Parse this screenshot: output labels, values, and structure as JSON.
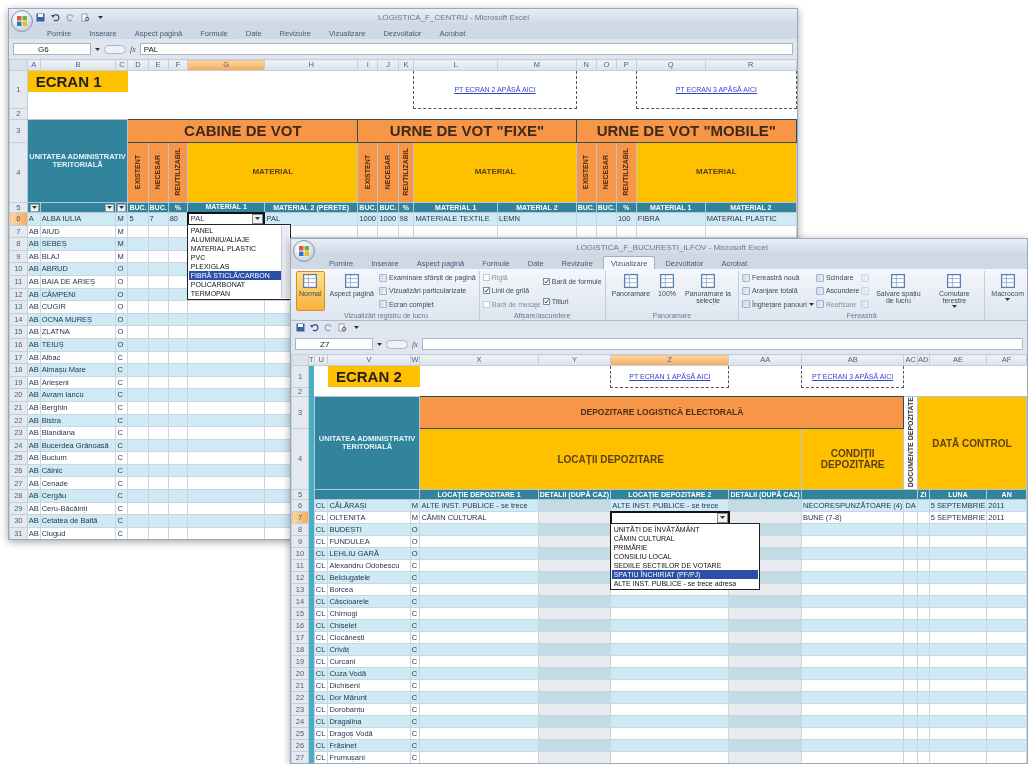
{
  "windows": [
    {
      "title": "LOGISTICA_F_CENTRU - Microsoft Excel",
      "tabs": [
        {
          "label": "Pornire",
          "selected": false
        },
        {
          "label": "Inserare",
          "selected": false
        },
        {
          "label": "Aspect pagină",
          "selected": false
        },
        {
          "label": "Formule",
          "selected": false
        },
        {
          "label": "Date",
          "selected": false
        },
        {
          "label": "Revizuire",
          "selected": false
        },
        {
          "label": "Vizualizare",
          "selected": false
        },
        {
          "label": "Dezvoltator",
          "selected": false
        },
        {
          "label": "Acrobat",
          "selected": false
        }
      ],
      "name_box": "G6",
      "function_label": "fx",
      "formula": "PAL",
      "columns": [
        {
          "label": "A",
          "selected": false
        },
        {
          "label": "B",
          "selected": false
        },
        {
          "label": "C",
          "selected": false
        },
        {
          "label": "D",
          "selected": false
        },
        {
          "label": "E",
          "selected": false
        },
        {
          "label": "F",
          "selected": false
        },
        {
          "label": "G",
          "selected": true
        },
        {
          "label": "H",
          "selected": false
        },
        {
          "label": "I",
          "selected": false
        },
        {
          "label": "J",
          "selected": false
        },
        {
          "label": "K",
          "selected": false
        },
        {
          "label": "L",
          "selected": false
        },
        {
          "label": "M",
          "selected": false
        },
        {
          "label": "N",
          "selected": false
        },
        {
          "label": "O",
          "selected": false
        },
        {
          "label": "P",
          "selected": false
        },
        {
          "label": "Q",
          "selected": false
        },
        {
          "label": "R",
          "selected": false
        }
      ],
      "header_rows": [
        {
          "number": "1",
          "cells": [
            {
              "kind": "title",
              "text": "ECRAN 1"
            },
            {
              "kind": "link",
              "text": "PT ECRAN 2 APĂSĂ AICI"
            },
            {
              "kind": "link",
              "text": "PT ECRAN 3 APĂSĂ AICI"
            }
          ]
        },
        {
          "number": "2",
          "cells": []
        },
        {
          "number": "3",
          "cells": [
            {
              "kind": "teal",
              "text": "UNITATEA ADMINISTRATIV TERITORIALĂ"
            },
            {
              "kind": "section",
              "text": "CABINE DE VOT"
            },
            {
              "kind": "section",
              "text": "URNE DE VOT \"FIXE\""
            },
            {
              "kind": "section",
              "text": "URNE DE VOT \"MOBILE\""
            }
          ]
        },
        {
          "number": "4",
          "cells": [
            {
              "kind": "vorange",
              "text": "EXISTENT"
            },
            {
              "kind": "vorange",
              "text": "NECESAR"
            },
            {
              "kind": "vorange",
              "text": "REUTILIZABIL"
            },
            {
              "kind": "yellow",
              "text": "MATERIAL"
            },
            {
              "kind": "vorange",
              "text": "EXISTENT"
            },
            {
              "kind": "vorange",
              "text": "NECESAR"
            },
            {
              "kind": "vorange",
              "text": "REUTILIZABIL"
            },
            {
              "kind": "yellow",
              "text": "MATERIAL"
            },
            {
              "kind": "vorange",
              "text": "EXISTENT"
            },
            {
              "kind": "vorange",
              "text": "NECESAR"
            },
            {
              "kind": "vorange",
              "text": "REUTILIZABIL"
            },
            {
              "kind": "yellow",
              "text": "MATERIAL"
            }
          ]
        },
        {
          "number": "5",
          "cells": [
            {
              "kind": "filter"
            },
            {
              "kind": "filter"
            },
            {
              "kind": "filter"
            },
            {
              "kind": "dark",
              "text": "BUC."
            },
            {
              "kind": "dark",
              "text": "BUC."
            },
            {
              "kind": "dark",
              "text": "%"
            },
            {
              "kind": "dark",
              "text": "MATERIAL 1"
            },
            {
              "kind": "dark",
              "text": "MATERIAL 2 (PERETE)"
            },
            {
              "kind": "dark",
              "text": "BUC."
            },
            {
              "kind": "dark",
              "text": "BUC."
            },
            {
              "kind": "dark",
              "text": "%"
            },
            {
              "kind": "dark",
              "text": "MATERIAL 1"
            },
            {
              "kind": "dark",
              "text": "MATERIAL 2"
            },
            {
              "kind": "dark",
              "text": "BUC."
            },
            {
              "kind": "dark",
              "text": "BUC."
            },
            {
              "kind": "dark",
              "text": "%"
            },
            {
              "kind": "dark",
              "text": "MATERIAL 1"
            },
            {
              "kind": "dark",
              "text": "MATERIAL 2"
            }
          ]
        }
      ],
      "rows": [
        {
          "number": "6",
          "selected": true,
          "cells": [
            "A",
            "ALBA IULIA",
            "M",
            "5",
            "7",
            "80",
            "PAL",
            "PAL",
            "1000",
            "1000",
            "98",
            "MATERIALE TEXTILE",
            "LEMN",
            null,
            null,
            "100",
            "FIBRA",
            "MATERIAL PLASTIC"
          ]
        },
        {
          "number": "7",
          "selected": false,
          "cells": [
            "AB",
            "AIUD",
            "M"
          ]
        },
        {
          "number": "8",
          "selected": false,
          "cells": [
            "AB",
            "SEBEȘ",
            "M"
          ]
        },
        {
          "number": "9",
          "selected": false,
          "cells": [
            "AB",
            "BLAJ",
            "M"
          ]
        },
        {
          "number": "10",
          "selected": false,
          "cells": [
            "AB",
            "ABRUD",
            "O"
          ]
        },
        {
          "number": "11",
          "selected": false,
          "cells": [
            "AB",
            "BAIA DE ARIEȘ",
            "O"
          ]
        },
        {
          "number": "12",
          "selected": false,
          "cells": [
            "AB",
            "CÂMPENI",
            "O"
          ]
        },
        {
          "number": "13",
          "selected": false,
          "cells": [
            "AB",
            "CUGIR",
            "O"
          ]
        },
        {
          "number": "14",
          "selected": false,
          "cells": [
            "AB",
            "OCNA MUREȘ",
            "O"
          ]
        },
        {
          "number": "15",
          "selected": false,
          "cells": [
            "AB",
            "ZLATNA",
            "O"
          ]
        },
        {
          "number": "16",
          "selected": false,
          "cells": [
            "AB",
            "TEIUȘ",
            "O"
          ]
        },
        {
          "number": "17",
          "selected": false,
          "cells": [
            "AB",
            "Albac",
            "C"
          ]
        },
        {
          "number": "18",
          "selected": false,
          "cells": [
            "AB",
            "Almașu Mare",
            "C"
          ]
        },
        {
          "number": "19",
          "selected": false,
          "cells": [
            "AB",
            "Arieșeni",
            "C"
          ]
        },
        {
          "number": "20",
          "selected": false,
          "cells": [
            "AB",
            "Avram Iancu",
            "C"
          ]
        },
        {
          "number": "21",
          "selected": false,
          "cells": [
            "AB",
            "Berghin",
            "C"
          ]
        },
        {
          "number": "22",
          "selected": false,
          "cells": [
            "AB",
            "Bistra",
            "C"
          ]
        },
        {
          "number": "23",
          "selected": false,
          "cells": [
            "AB",
            "Blandiana",
            "C"
          ]
        },
        {
          "number": "24",
          "selected": false,
          "cells": [
            "AB",
            "Bucerdea Grânoasă",
            "C"
          ]
        },
        {
          "number": "25",
          "selected": false,
          "cells": [
            "AB",
            "Bucium",
            "C"
          ]
        },
        {
          "number": "26",
          "selected": false,
          "cells": [
            "AB",
            "Câlnic",
            "C"
          ]
        },
        {
          "number": "27",
          "selected": false,
          "cells": [
            "AB",
            "Cenade",
            "C"
          ]
        },
        {
          "number": "28",
          "selected": false,
          "cells": [
            "AB",
            "Cergău",
            "C"
          ]
        },
        {
          "number": "29",
          "selected": false,
          "cells": [
            "AB",
            "Ceru-Băcăinți",
            "C"
          ]
        },
        {
          "number": "30",
          "selected": false,
          "cells": [
            "AB",
            "Cetatea de Baltă",
            "C"
          ]
        },
        {
          "number": "31",
          "selected": false,
          "cells": [
            "AB",
            "Ciugud",
            "C"
          ]
        }
      ],
      "dropdown": [
        {
          "label": "PANEL",
          "selected": false
        },
        {
          "label": "ALUMINIU/ALIAJE",
          "selected": false
        },
        {
          "label": "MATERIAL PLASTIC",
          "selected": false
        },
        {
          "label": "PVC",
          "selected": false
        },
        {
          "label": "PLEXIGLAS",
          "selected": false
        },
        {
          "label": "FIBRĂ STICLĂ/CARBON",
          "selected": true
        },
        {
          "label": "POLICARBONAT",
          "selected": false
        },
        {
          "label": "TERMOPAN",
          "selected": false
        }
      ]
    },
    {
      "title": "LOGISTICA_F_BUCUREȘTI_ILFOV - Microsoft Excel",
      "tabs": [
        {
          "label": "Pornire",
          "selected": false
        },
        {
          "label": "Inserare",
          "selected": false
        },
        {
          "label": "Aspect pagină",
          "selected": false
        },
        {
          "label": "Formule",
          "selected": false
        },
        {
          "label": "Date",
          "selected": false
        },
        {
          "label": "Revizuire",
          "selected": false
        },
        {
          "label": "Vizualizare",
          "selected": true
        },
        {
          "label": "Dezvoltator",
          "selected": false
        },
        {
          "label": "Acrobat",
          "selected": false
        }
      ],
      "ribbon": [
        {
          "label": "Vizualizări registru de lucru",
          "items": [
            {
              "kind": "large",
              "label": "Normal",
              "selected": true
            },
            {
              "kind": "large",
              "label": "Aspect pagină",
              "selected": false
            },
            {
              "kind": "small",
              "label": "Examinare sfârșit de pagină",
              "disabled": false
            },
            {
              "kind": "small",
              "label": "Vizualizări particularizate",
              "disabled": false
            },
            {
              "kind": "small",
              "label": "Ecran complet",
              "disabled": false
            }
          ]
        },
        {
          "label": "Afișare/ascundere",
          "items": [
            {
              "kind": "check",
              "label": "Riglă",
              "checked": false,
              "disabled": true
            },
            {
              "kind": "check",
              "label": "Linii de grilă",
              "checked": true,
              "disabled": false
            },
            {
              "kind": "check",
              "label": "Bară de mesaje",
              "checked": false,
              "disabled": true
            },
            {
              "kind": "check",
              "label": "Bară de formule",
              "checked": true,
              "disabled": false
            },
            {
              "kind": "check",
              "label": "Titluri",
              "checked": true,
              "disabled": false
            }
          ]
        },
        {
          "label": "Panoramare",
          "items": [
            {
              "kind": "large",
              "label": "Panoramare",
              "selected": false
            },
            {
              "kind": "large",
              "label": "100%",
              "selected": false
            },
            {
              "kind": "large",
              "label": "Panoramare la selecție",
              "selected": false
            }
          ]
        },
        {
          "label": "Fereastră",
          "items": [
            {
              "kind": "small",
              "label": "Fereastră nouă",
              "disabled": false
            },
            {
              "kind": "small",
              "label": "Aranjare totală",
              "disabled": false
            },
            {
              "kind": "menu",
              "label": "Înghețare panouri",
              "disabled": false
            },
            {
              "kind": "small",
              "label": "Scindare",
              "disabled": false
            },
            {
              "kind": "small",
              "label": "Ascundere",
              "disabled": false
            },
            {
              "kind": "small",
              "label": "Reafișare",
              "disabled": true
            },
            {
              "kind": "icon",
              "disabled": true
            },
            {
              "kind": "icon",
              "disabled": true
            },
            {
              "kind": "icon",
              "disabled": true
            },
            {
              "kind": "large",
              "label": "Salvare spațiu de lucru",
              "selected": false
            },
            {
              "kind": "dropdown",
              "label": "Comutare ferestre",
              "selected": false
            }
          ]
        },
        {
          "items": [
            {
              "kind": "dropdown",
              "label": "Macrocom",
              "selected": false
            }
          ]
        }
      ],
      "name_box": "Z7",
      "function_label": "fx",
      "columns": [
        {
          "label": "T",
          "selected": false
        },
        {
          "label": "U",
          "selected": false
        },
        {
          "label": "V",
          "selected": false
        },
        {
          "label": "W",
          "selected": false
        },
        {
          "label": "X",
          "selected": false
        },
        {
          "label": "Y",
          "selected": false
        },
        {
          "label": "Z",
          "selected": true
        },
        {
          "label": "AA",
          "selected": false
        },
        {
          "label": "AB",
          "selected": false
        },
        {
          "label": "AC",
          "selected": false
        },
        {
          "label": "AD",
          "selected": false
        },
        {
          "label": "AE",
          "selected": false
        },
        {
          "label": "AF",
          "selected": false
        }
      ],
      "header_rows": [
        {
          "number": "1",
          "cells": [
            {
              "kind": "title",
              "text": "ECRAN 2"
            },
            {
              "kind": "link",
              "text": "PT ECRAN 1 APĂSĂ AICI"
            },
            {
              "kind": "link",
              "text": "PT ECRAN 3 APĂSĂ AICI"
            }
          ]
        },
        {
          "number": "2",
          "cells": []
        },
        {
          "number": "3",
          "cells": [
            {
              "kind": "teal",
              "text": "UNITATEA ADMINISTRATIV TERITORIALĂ"
            },
            {
              "kind": "band",
              "text": "DEPOZITARE LOGISTICĂ ELECTORALĂ"
            },
            {
              "kind": "vwhite",
              "text": "DOCUMENTE DEPOZITATE"
            },
            {
              "kind": "gold",
              "text": "DATĂ CONTROL"
            }
          ]
        },
        {
          "number": "4",
          "cells": [
            {
              "kind": "gold",
              "text": "LOCAȚII DEPOZITARE"
            },
            {
              "kind": "gold",
              "text": "CONDIȚII DEPOZITARE"
            }
          ]
        },
        {
          "number": "5",
          "cells": [
            {
              "kind": "dark",
              "text": "LOCAȚIE DEPOZITARE 1"
            },
            {
              "kind": "dark",
              "text": "DETALII (DUPĂ CAZ)"
            },
            {
              "kind": "dark",
              "text": "LOCAȚIE DEPOZITARE 2"
            },
            {
              "kind": "dark",
              "text": "DETALII (DUPĂ CAZ)"
            },
            {
              "kind": "dark",
              "text": "ZI"
            },
            {
              "kind": "dark",
              "text": "LUNA"
            },
            {
              "kind": "dark",
              "text": "AN"
            }
          ]
        }
      ],
      "rows": [
        {
          "number": "6",
          "selected": false,
          "cells": [
            null,
            "CL",
            "CĂLĂRAȘI",
            "M",
            "ALTE INST. PUBLICE - se trece",
            null,
            "ALTE INST. PUBLICE - se trece",
            null,
            "NECORESPUNZĂTOARE (4)",
            "DA",
            null,
            "5 SEPTEMBRIE",
            "2011"
          ]
        },
        {
          "number": "7",
          "selected": true,
          "cells": [
            null,
            "CL",
            "OLTENIȚA",
            "M",
            "CĂMIN CULTURAL",
            null,
            null,
            null,
            "BUNE (7-8)",
            null,
            null,
            "5 SEPTEMBRIE",
            "2011"
          ]
        },
        {
          "number": "8",
          "selected": false,
          "cells": [
            null,
            "CL",
            "BUDEȘTI",
            "O"
          ]
        },
        {
          "number": "9",
          "selected": false,
          "cells": [
            null,
            "CL",
            "FUNDULEA",
            "O"
          ]
        },
        {
          "number": "10",
          "selected": false,
          "cells": [
            null,
            "CL",
            "LEHLIU GARĂ",
            "O"
          ]
        },
        {
          "number": "11",
          "selected": false,
          "cells": [
            null,
            "CL",
            "Alexandru Odobescu",
            "C"
          ]
        },
        {
          "number": "12",
          "selected": false,
          "cells": [
            null,
            "CL",
            "Belciugatele",
            "C"
          ]
        },
        {
          "number": "13",
          "selected": false,
          "cells": [
            null,
            "CL",
            "Borcea",
            "C"
          ]
        },
        {
          "number": "14",
          "selected": false,
          "cells": [
            null,
            "CL",
            "Căscioarele",
            "C"
          ]
        },
        {
          "number": "15",
          "selected": false,
          "cells": [
            null,
            "CL",
            "Chirnogi",
            "C"
          ]
        },
        {
          "number": "16",
          "selected": false,
          "cells": [
            null,
            "CL",
            "Chiselet",
            "C"
          ]
        },
        {
          "number": "17",
          "selected": false,
          "cells": [
            null,
            "CL",
            "Ciocănești",
            "C"
          ]
        },
        {
          "number": "18",
          "selected": false,
          "cells": [
            null,
            "CL",
            "Crivăț",
            "C"
          ]
        },
        {
          "number": "19",
          "selected": false,
          "cells": [
            null,
            "CL",
            "Curcani",
            "C"
          ]
        },
        {
          "number": "20",
          "selected": false,
          "cells": [
            null,
            "CL",
            "Cuza Vodă",
            "C"
          ]
        },
        {
          "number": "21",
          "selected": false,
          "cells": [
            null,
            "CL",
            "Dichiseni",
            "C"
          ]
        },
        {
          "number": "22",
          "selected": false,
          "cells": [
            null,
            "CL",
            "Dor Mărunt",
            "C"
          ]
        },
        {
          "number": "23",
          "selected": false,
          "cells": [
            null,
            "CL",
            "Dorobanțu",
            "C"
          ]
        },
        {
          "number": "24",
          "selected": false,
          "cells": [
            null,
            "CL",
            "Dragalina",
            "C"
          ]
        },
        {
          "number": "25",
          "selected": false,
          "cells": [
            null,
            "CL",
            "Dragoș Vodă",
            "C"
          ]
        },
        {
          "number": "26",
          "selected": false,
          "cells": [
            null,
            "CL",
            "Frăsinet",
            "C"
          ]
        },
        {
          "number": "27",
          "selected": false,
          "cells": [
            null,
            "CL",
            "Frumușani",
            "C"
          ]
        }
      ],
      "dropdown": [
        {
          "label": "UNITĂȚI DE ÎNVĂȚĂMÂNT",
          "selected": false
        },
        {
          "label": "CĂMIN CULTURAL",
          "selected": false
        },
        {
          "label": "PRIMĂRIE",
          "selected": false
        },
        {
          "label": "CONSILIU LOCAL",
          "selected": false
        },
        {
          "label": "SEDIILE SECȚIILOR DE VOTARE",
          "selected": false
        },
        {
          "label": "SPAȚIU ÎNCHIRIAT (PF/PJ)",
          "selected": true
        },
        {
          "label": "ALTE INST. PUBLICE - se trece adresa",
          "selected": false
        }
      ]
    }
  ]
}
